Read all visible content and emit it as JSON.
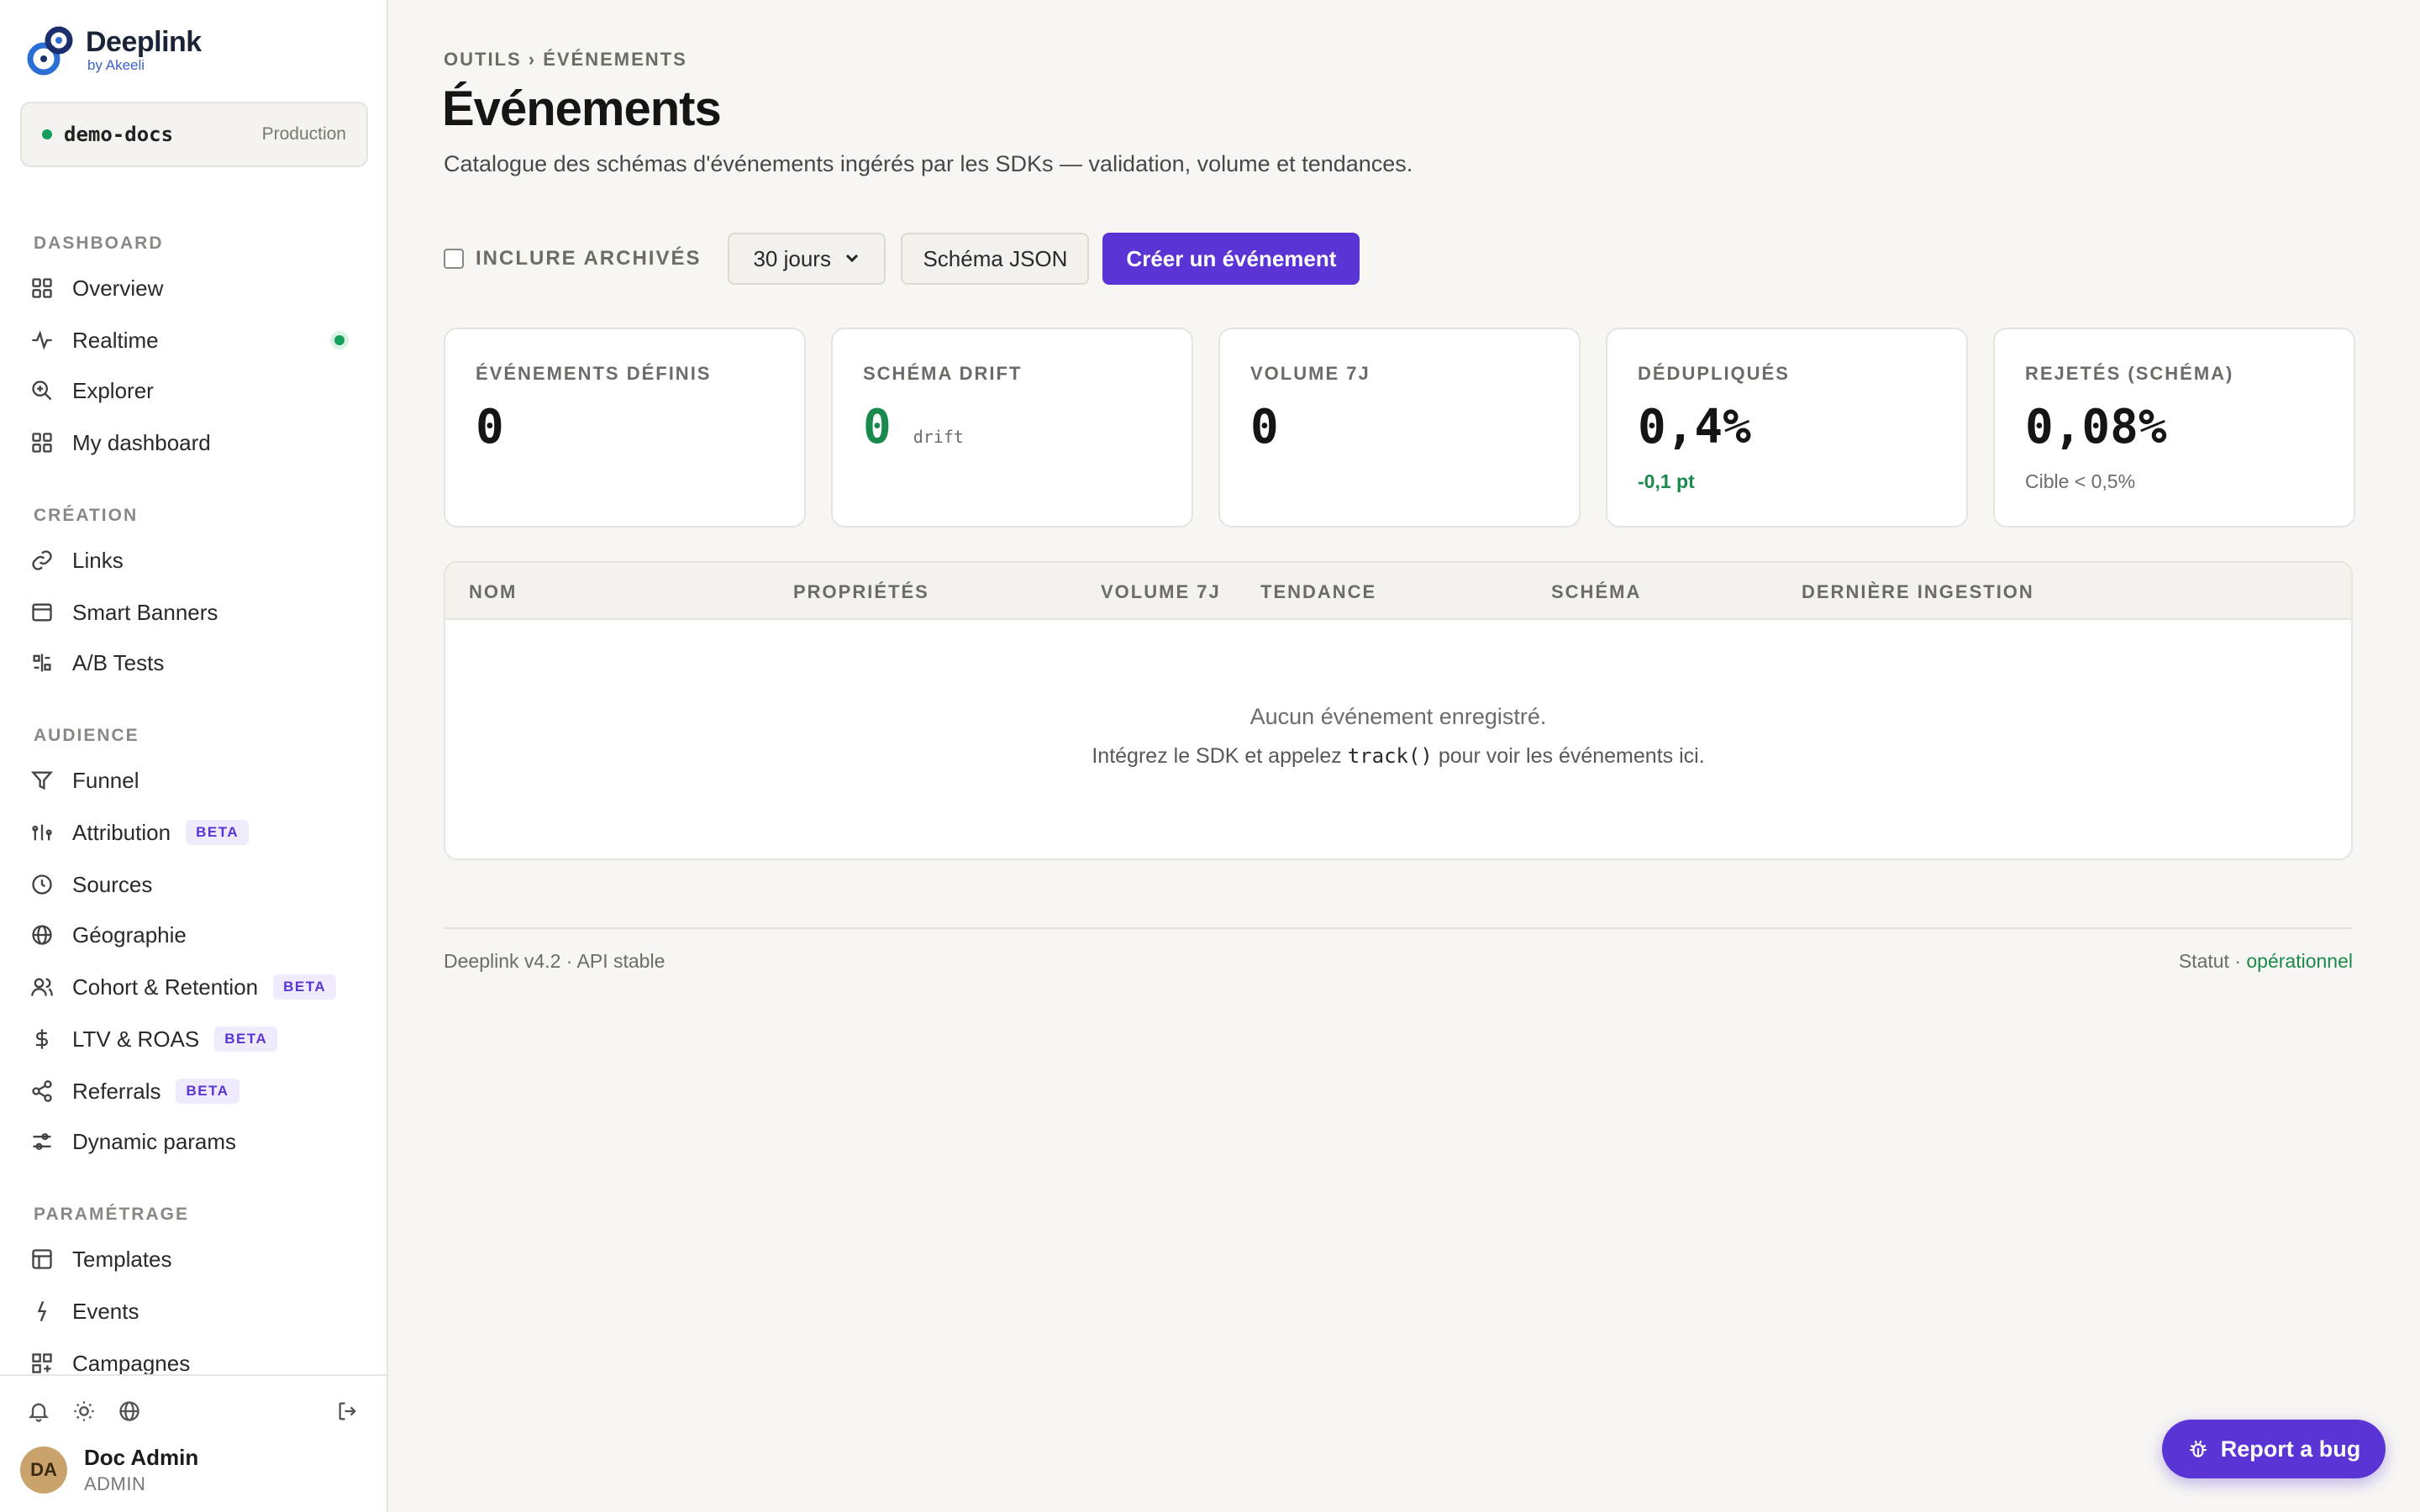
{
  "brand": {
    "name": "Deeplink",
    "sub": "by Akeeli"
  },
  "project": {
    "name": "demo-docs",
    "env": "Production"
  },
  "sidebar": {
    "sections": [
      {
        "title": "DASHBOARD"
      },
      {
        "title": "CRÉATION"
      },
      {
        "title": "AUDIENCE"
      },
      {
        "title": "PARAMÉTRAGE"
      }
    ],
    "items": [
      {
        "label": "Overview",
        "icon": "grid-icon"
      },
      {
        "label": "Realtime",
        "icon": "activity-icon"
      },
      {
        "label": "Explorer",
        "icon": "zoom-icon"
      },
      {
        "label": "My dashboard",
        "icon": "grid-icon"
      },
      {
        "label": "Links",
        "icon": "link-icon"
      },
      {
        "label": "Smart Banners",
        "icon": "banner-icon"
      },
      {
        "label": "A/B Tests",
        "icon": "split-icon"
      },
      {
        "label": "Funnel",
        "icon": "funnel-icon"
      },
      {
        "label": "Attribution",
        "icon": "attribution-icon",
        "badge": "BETA"
      },
      {
        "label": "Sources",
        "icon": "clock-icon"
      },
      {
        "label": "Géographie",
        "icon": "globe-icon"
      },
      {
        "label": "Cohort & Retention",
        "icon": "users-icon",
        "badge": "BETA"
      },
      {
        "label": "LTV & ROAS",
        "icon": "dollar-icon",
        "badge": "BETA"
      },
      {
        "label": "Referrals",
        "icon": "share-icon",
        "badge": "BETA"
      },
      {
        "label": "Dynamic params",
        "icon": "sliders-icon"
      },
      {
        "label": "Templates",
        "icon": "template-icon"
      },
      {
        "label": "Events",
        "icon": "bolt-icon"
      },
      {
        "label": "Campagnes",
        "icon": "campaign-icon"
      }
    ]
  },
  "user": {
    "initials": "DA",
    "name": "Doc Admin",
    "role": "ADMIN"
  },
  "main": {
    "breadcrumb": "OUTILS › ÉVÉNEMENTS",
    "title": "Événements",
    "description": "Catalogue des schémas d'événements ingérés par les SDKs — validation, volume et tendances.",
    "include_archived": "INCLURE ARCHIVÉS",
    "period": "30 jours",
    "schema_button": "Schéma JSON",
    "create_button": "Créer un événement"
  },
  "stats": [
    {
      "label": "ÉVÉNEMENTS DÉFINIS",
      "value": "0",
      "unit": "",
      "sub": ""
    },
    {
      "label": "SCHÉMA DRIFT",
      "value": "0",
      "unit": "drift",
      "sub": ""
    },
    {
      "label": "VOLUME 7J",
      "value": "0",
      "unit": "",
      "sub": ""
    },
    {
      "label": "DÉDUPLIQUÉS",
      "value": "0,4%",
      "unit": "",
      "sub": "-0,1 pt"
    },
    {
      "label": "REJETÉS (SCHÉMA)",
      "value": "0,08%",
      "unit": "",
      "sub": "Cible < 0,5%"
    }
  ],
  "table": {
    "columns": [
      "NOM",
      "PROPRIÉTÉS",
      "VOLUME 7J",
      "TENDANCE",
      "SCHÉMA",
      "DERNIÈRE INGESTION"
    ],
    "empty_title": "Aucun événement enregistré.",
    "empty_before": "Intégrez le SDK et appelez",
    "empty_code": "track()",
    "empty_after": "pour voir les événements ici."
  },
  "footer": {
    "version": "Deeplink v4.2 · API stable",
    "status_label": "Statut ·",
    "status_value": "opérationnel"
  },
  "report_bug": "Report a bug",
  "colors": {
    "accent": "#5b34d6",
    "success": "#1a8a4c",
    "brand_blue": "#3b63c8"
  }
}
